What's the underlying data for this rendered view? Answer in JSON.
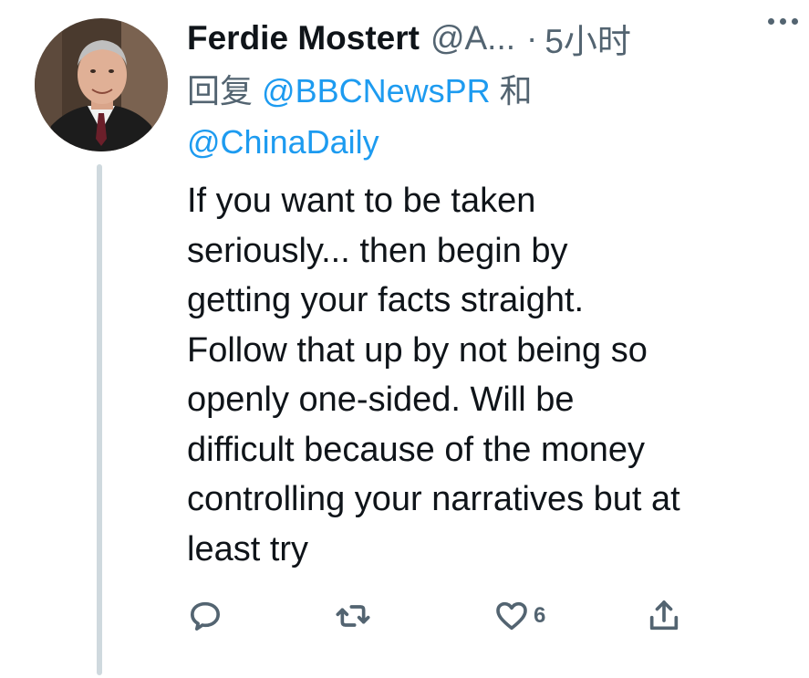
{
  "tweet": {
    "author_name": "Ferdie Mostert",
    "author_handle": "@A...",
    "separator": "·",
    "timestamp": "5小时",
    "reply_prefix": "回复",
    "reply_mention_1": "@BBCNewsPR",
    "reply_conjunction": "和",
    "reply_mention_2": "@ChinaDaily",
    "text": "If you want to be taken\nseriously... then begin by\ngetting your facts straight.\nFollow that up by not being so\nopenly one-sided. Will be\ndifficult because of the money\ncontrolling your narratives but at\nleast try"
  },
  "actions": {
    "reply_icon": "speech-bubble-icon",
    "retweet_icon": "retweet-icon",
    "like_icon": "heart-icon",
    "like_count": "6",
    "share_icon": "share-upload-icon"
  },
  "colors": {
    "text_primary": "#0f1419",
    "text_secondary": "#536471",
    "link": "#1d9bf0",
    "thread_line": "#cfd9de"
  }
}
